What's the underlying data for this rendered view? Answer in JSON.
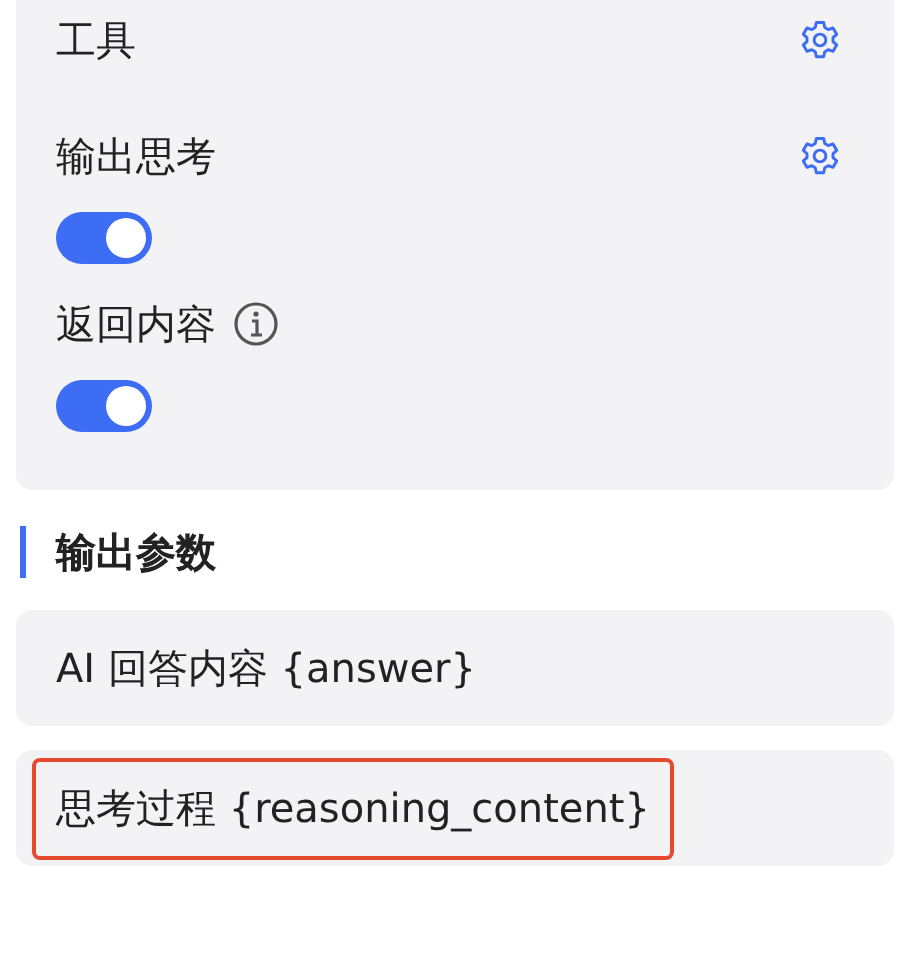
{
  "settings": [
    {
      "kind": "gear",
      "label": "工具"
    },
    {
      "kind": "gear-toggle",
      "label": "输出思考",
      "on": true
    },
    {
      "kind": "info-toggle",
      "label": "返回内容",
      "on": true
    }
  ],
  "output_section": {
    "title": "输出参数",
    "items": [
      {
        "label": "AI 回答内容 {answer}",
        "highlighted": false
      },
      {
        "label": "思考过程 {reasoning_content}",
        "highlighted": true
      }
    ]
  }
}
